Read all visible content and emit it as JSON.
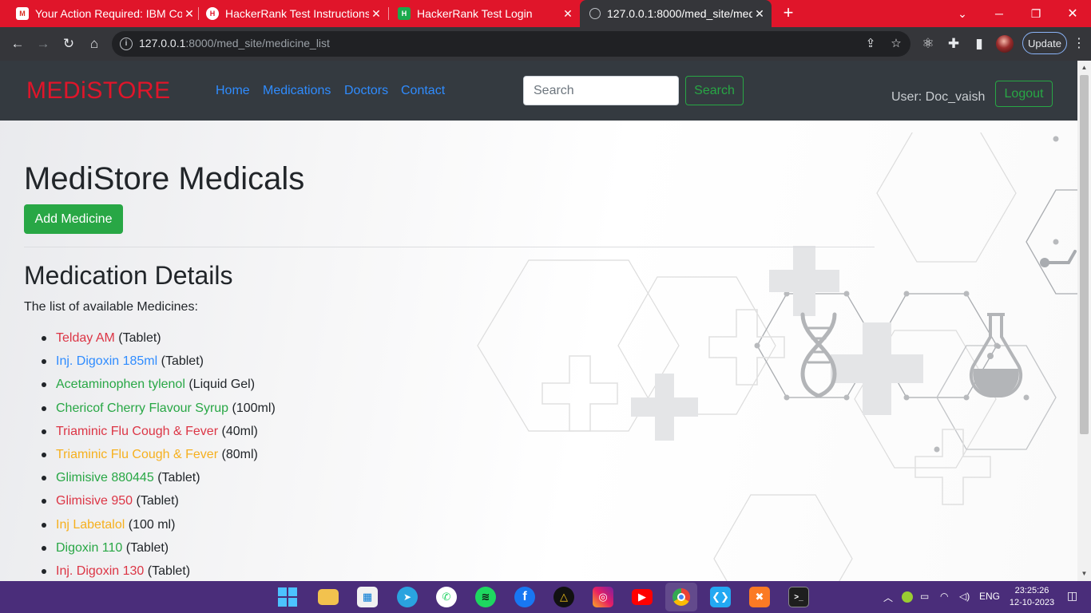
{
  "browser": {
    "tabs": [
      {
        "title": "Your Action Required: IBM Co",
        "favicon": "gmail-icon"
      },
      {
        "title": "HackerRank Test Instructions",
        "favicon": "hackerrank-icon"
      },
      {
        "title": "HackerRank Test Login",
        "favicon": "hackerrank-icon"
      },
      {
        "title": "127.0.0.1:8000/med_site/medi",
        "favicon": "globe-icon"
      }
    ],
    "url_host": "127.0.0.1",
    "url_path": ":8000/med_site/medicine_list",
    "update_label": "Update"
  },
  "site": {
    "brand": "MEDiSTORE",
    "nav": [
      "Home",
      "Medications",
      "Doctors",
      "Contact"
    ],
    "search_placeholder": "Search",
    "search_button": "Search",
    "user_label": "User: Doc_vaish",
    "logout_label": "Logout",
    "title": "MediStore Medicals",
    "add_button": "Add Medicine",
    "section_title": "Medication Details",
    "intro": "The list of available Medicines:",
    "medicines": [
      {
        "name": "Telday AM",
        "form": "(Tablet)",
        "color": "#dc3545"
      },
      {
        "name": "Inj. Digoxin 185ml",
        "form": "(Tablet)",
        "color": "#2f8cff"
      },
      {
        "name": "Acetaminophen tylenol",
        "form": "(Liquid Gel)",
        "color": "#28a745"
      },
      {
        "name": "Chericof Cherry Flavour Syrup",
        "form": "(100ml)",
        "color": "#28a745"
      },
      {
        "name": "Triaminic Flu Cough & Fever",
        "form": "(40ml)",
        "color": "#dc3545"
      },
      {
        "name": "Triaminic Flu Cough & Fever",
        "form": "(80ml)",
        "color": "#f6b01e"
      },
      {
        "name": "Glimisive 880445",
        "form": "(Tablet)",
        "color": "#28a745"
      },
      {
        "name": "Glimisive 950",
        "form": "(Tablet)",
        "color": "#dc3545"
      },
      {
        "name": "Inj Labetalol",
        "form": "(100 ml)",
        "color": "#f6b01e"
      },
      {
        "name": "Digoxin 110",
        "form": "(Tablet)",
        "color": "#28a745"
      },
      {
        "name": "Inj. Digoxin 130",
        "form": "(Tablet)",
        "color": "#dc3545"
      }
    ]
  },
  "taskbar": {
    "apps": [
      "windows-start-icon",
      "file-explorer-icon",
      "microsoft-store-icon",
      "telegram-icon",
      "whatsapp-icon",
      "spotify-icon",
      "facebook-icon",
      "google-drive-icon",
      "instagram-icon",
      "youtube-icon",
      "chrome-icon",
      "vscode-icon",
      "xampp-icon",
      "terminal-icon"
    ],
    "language": "ENG",
    "time": "23:25:26",
    "date": "12-10-2023"
  }
}
